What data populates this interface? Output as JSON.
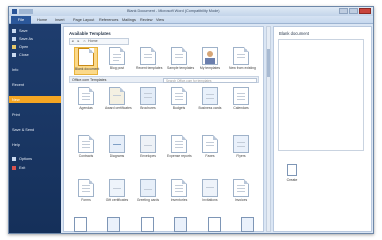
{
  "window": {
    "title": "Blank Document - Microsoft Word (Compatibility Mode)"
  },
  "ribbon": {
    "tabs": [
      {
        "label": "File"
      },
      {
        "label": "Home"
      },
      {
        "label": "Insert"
      },
      {
        "label": "Page Layout"
      },
      {
        "label": "References"
      },
      {
        "label": "Mailings"
      },
      {
        "label": "Review"
      },
      {
        "label": "View"
      }
    ]
  },
  "backstage": {
    "items": [
      {
        "label": "Save",
        "icon": "save-icon"
      },
      {
        "label": "Save As",
        "icon": "save-as-icon"
      },
      {
        "label": "Open",
        "icon": "folder-icon"
      },
      {
        "label": "Close",
        "icon": "close-doc-icon"
      },
      {
        "label": "Info",
        "icon": ""
      },
      {
        "label": "Recent",
        "icon": ""
      },
      {
        "label": "New",
        "icon": "",
        "selected": true
      },
      {
        "label": "Print",
        "icon": ""
      },
      {
        "label": "Save & Send",
        "icon": ""
      },
      {
        "label": "Help",
        "icon": ""
      },
      {
        "label": "Options",
        "icon": "options-icon"
      },
      {
        "label": "Exit",
        "icon": "exit-icon"
      }
    ]
  },
  "center": {
    "title": "Available Templates",
    "nav_home": "Home",
    "local_tiles": [
      {
        "label": "Blank document",
        "selected": true
      },
      {
        "label": "Blog post"
      },
      {
        "label": "Recent templates"
      },
      {
        "label": "Sample templates"
      },
      {
        "label": "My templates"
      },
      {
        "label": "New from existing"
      }
    ],
    "online_label": "Office.com Templates",
    "search_placeholder": "Search Office.com for templates",
    "online_tiles": [
      {
        "label": "Agendas"
      },
      {
        "label": "Award certificates"
      },
      {
        "label": "Brochures"
      },
      {
        "label": "Budgets"
      },
      {
        "label": "Business cards"
      },
      {
        "label": "Calendars"
      },
      {
        "label": "Contracts"
      },
      {
        "label": "Diagrams"
      },
      {
        "label": "Envelopes"
      },
      {
        "label": "Expense reports"
      },
      {
        "label": "Faxes"
      },
      {
        "label": "Flyers"
      },
      {
        "label": "Forms"
      },
      {
        "label": "Gift certificates"
      },
      {
        "label": "Greeting cards"
      },
      {
        "label": "Inventories"
      },
      {
        "label": "Invitations"
      },
      {
        "label": "Invoices"
      }
    ]
  },
  "right": {
    "title": "Blank document",
    "create_label": "Create"
  }
}
